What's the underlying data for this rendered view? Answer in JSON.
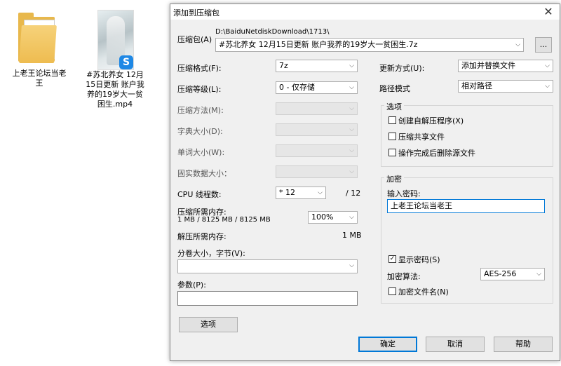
{
  "desktop": {
    "icons": [
      {
        "label_line1": "上老王论坛当老",
        "label_line2": "王"
      },
      {
        "label_line1": "#苏北养女 12月",
        "label_line2": "15日更新 账户我",
        "label_line3": "养的19岁大一贫",
        "label_line4": "困生.mp4"
      }
    ]
  },
  "dialog": {
    "title": "添加到压缩包",
    "archive_label": "压缩包(A)",
    "archive_path": "D:\\BaiduNetdiskDownload\\1713\\",
    "archive_name": "#苏北养女 12月15日更新 账户我养的19岁大一贫困生.7z",
    "browse_label": "...",
    "left": {
      "format_label": "压缩格式(F):",
      "format_value": "7z",
      "level_label": "压缩等级(L):",
      "level_value": "0 - 仅存储",
      "method_label": "压缩方法(M):",
      "dict_label": "字典大小(D):",
      "word_label": "单词大小(W):",
      "solid_label": "固实数据大小：",
      "cpu_label": "CPU 线程数:",
      "cpu_value": "* 12",
      "cpu_max": "/ 12",
      "mem_comp_label": "压缩所需内存:",
      "mem_comp_value": "1 MB / 8125 MB / 8125 MB",
      "mem_percent": "100%",
      "mem_decomp_label": "解压所需内存:",
      "mem_decomp_value": "1 MB",
      "volume_label": "分卷大小，字节(V):",
      "params_label": "参数(P):",
      "options_button": "选项"
    },
    "right": {
      "update_label": "更新方式(U):",
      "update_value": "添加并替换文件",
      "path_label": "路径模式",
      "path_value": "相对路径",
      "options_group": "选项",
      "opt_sfx": "创建自解压程序(X)",
      "opt_shared": "压缩共享文件",
      "opt_delete": "操作完成后删除源文件",
      "encrypt_group": "加密",
      "password_label": "输入密码:",
      "password_value": "上老王论坛当老王",
      "show_password": "显示密码(S)",
      "enc_method_label": "加密算法:",
      "enc_method_value": "AES-256",
      "enc_names": "加密文件名(N)"
    },
    "buttons": {
      "ok": "确定",
      "cancel": "取消",
      "help": "帮助"
    }
  }
}
